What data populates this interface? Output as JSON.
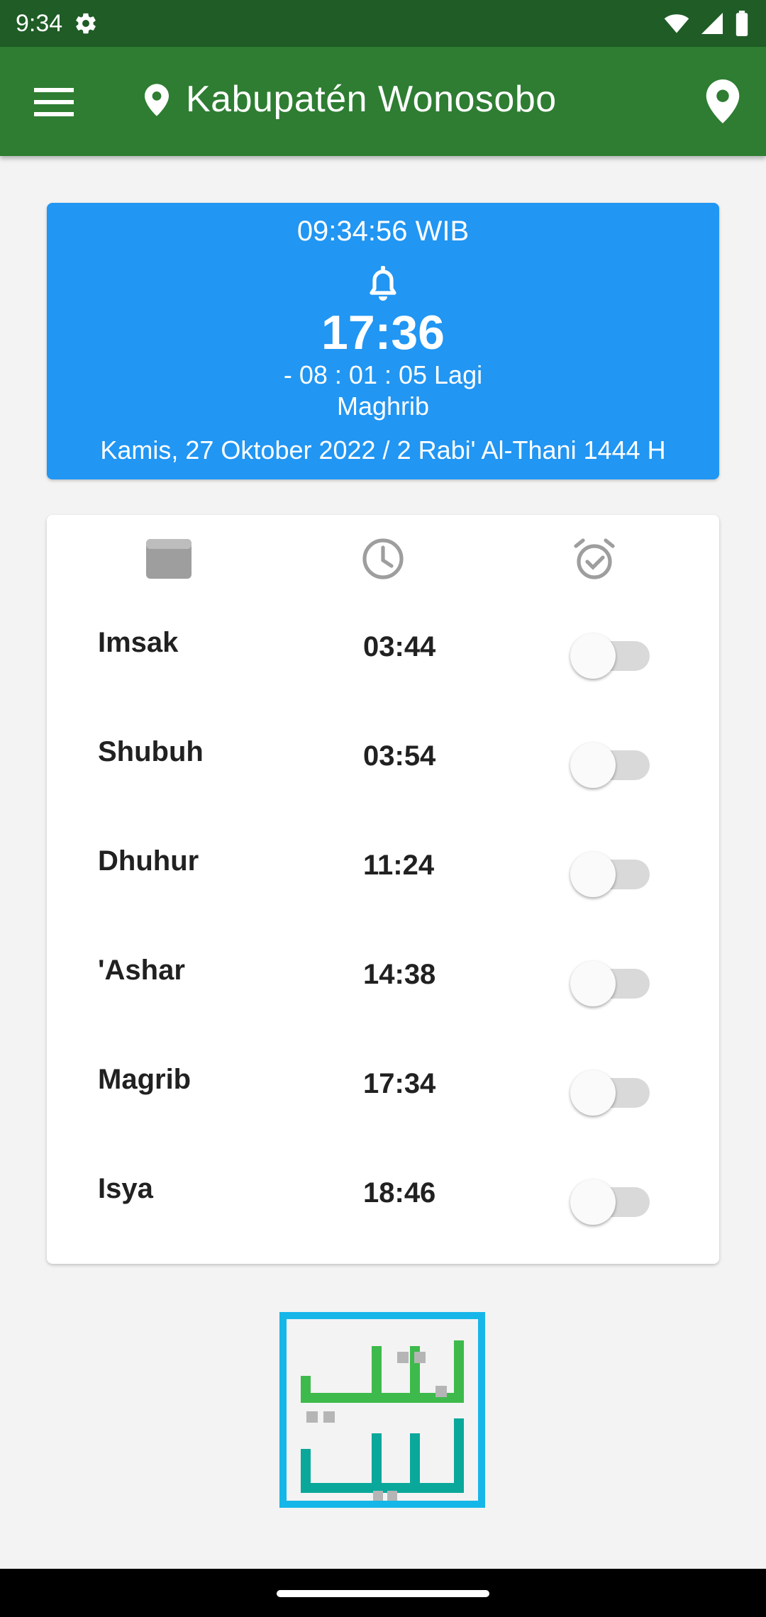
{
  "status_bar": {
    "time": "9:34"
  },
  "app_bar": {
    "location": "Kabupatén Wonosobo"
  },
  "hero": {
    "clock": "09:34:56 WIB",
    "next_time": "17:36",
    "countdown": "- 08 : 01 : 05 Lagi",
    "next_name": "Maghrib",
    "date": "Kamis, 27 Oktober 2022 / 2 Rabi' Al-Thani 1444 H"
  },
  "schedule": {
    "columns": [
      "name-icon",
      "clock-icon",
      "alarm-check-icon"
    ],
    "rows": [
      {
        "name": "Imsak",
        "time": "03:44",
        "alarm_on": false
      },
      {
        "name": "Shubuh",
        "time": "03:54",
        "alarm_on": false
      },
      {
        "name": "Dhuhur",
        "time": "11:24",
        "alarm_on": false
      },
      {
        "name": "'Ashar",
        "time": "14:38",
        "alarm_on": false
      },
      {
        "name": "Magrib",
        "time": "17:34",
        "alarm_on": false
      },
      {
        "name": "Isya",
        "time": "18:46",
        "alarm_on": false
      }
    ]
  },
  "colors": {
    "app_bar": "#2e7d32",
    "status_bar": "#1f5c26",
    "hero": "#2196f3",
    "logo_green": "#3dba4b",
    "logo_teal": "#0aa89b",
    "logo_border": "#16b6e8"
  }
}
